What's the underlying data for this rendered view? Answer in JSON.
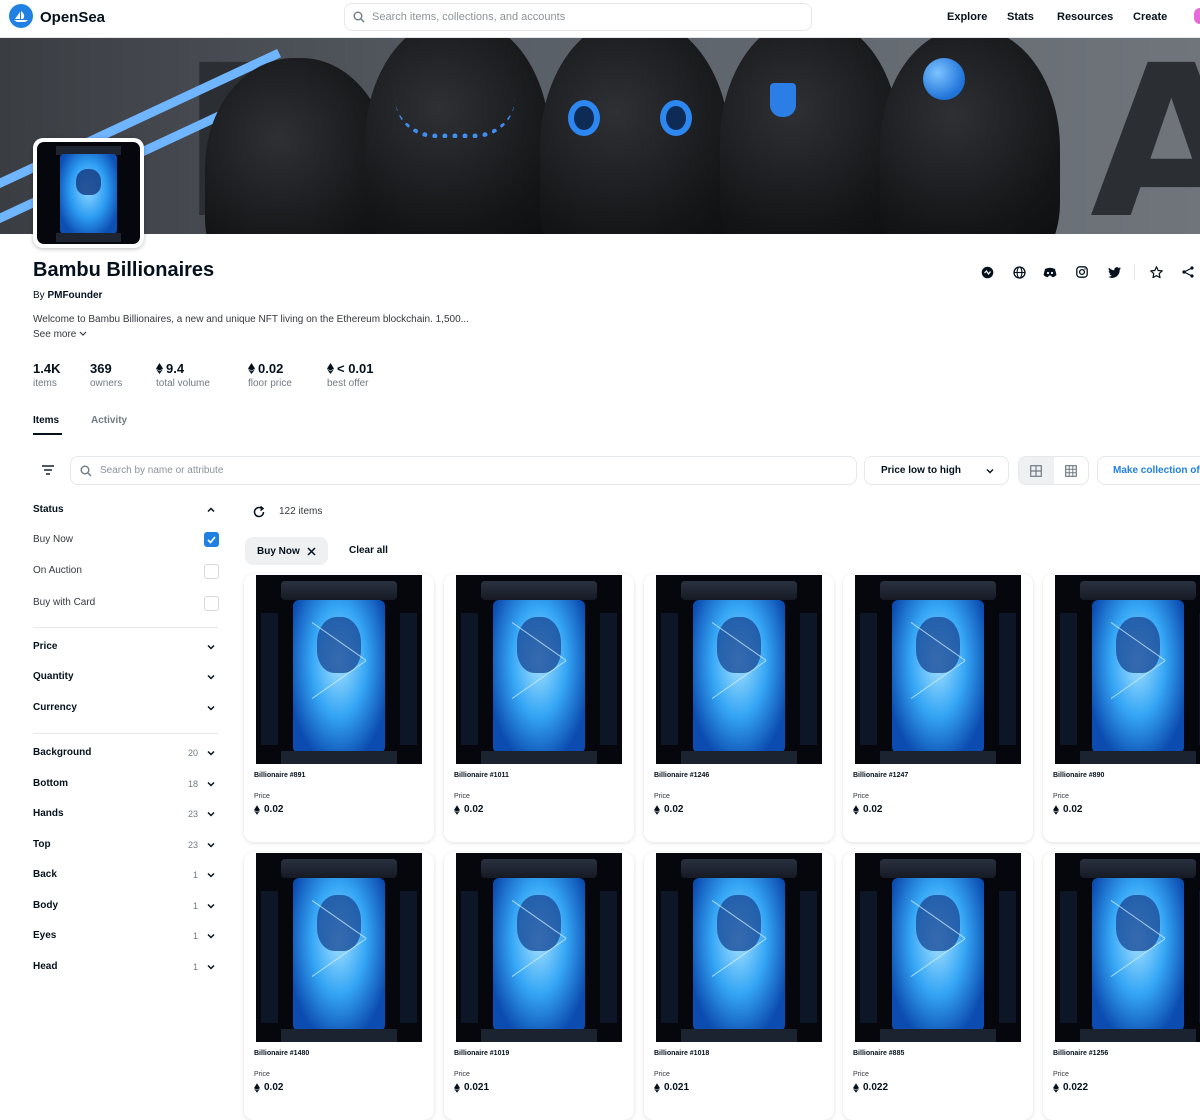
{
  "header": {
    "brand": "OpenSea",
    "search_placeholder": "Search items, collections, and accounts",
    "nav": [
      "Explore",
      "Stats",
      "Resources",
      "Create"
    ]
  },
  "collection": {
    "name": "Bambu Billionaires",
    "by_label": "By",
    "creator": "PMFounder",
    "description": "Welcome to Bambu Billionaires, a new and unique NFT living on the Ethereum blockchain. 1,500...",
    "see_more": "See more"
  },
  "stats": [
    {
      "value": "1.4K",
      "label": "items",
      "eth": false
    },
    {
      "value": "369",
      "label": "owners",
      "eth": false
    },
    {
      "value": "9.4",
      "label": "total volume",
      "eth": true
    },
    {
      "value": "0.02",
      "label": "floor price",
      "eth": true
    },
    {
      "value": "< 0.01",
      "label": "best offer",
      "eth": true
    }
  ],
  "tabs": [
    "Items",
    "Activity"
  ],
  "toolbar": {
    "search_placeholder": "Search by name or attribute",
    "sort": "Price low to high",
    "make_offer": "Make collection offer"
  },
  "sidebar": {
    "status_title": "Status",
    "status_options": [
      {
        "label": "Buy Now",
        "checked": true
      },
      {
        "label": "On Auction",
        "checked": false
      },
      {
        "label": "Buy with Card",
        "checked": false
      }
    ],
    "filters": [
      "Price",
      "Quantity",
      "Currency"
    ],
    "traits": [
      {
        "label": "Background",
        "count": "20"
      },
      {
        "label": "Bottom",
        "count": "18"
      },
      {
        "label": "Hands",
        "count": "23"
      },
      {
        "label": "Top",
        "count": "23"
      },
      {
        "label": "Back",
        "count": "1"
      },
      {
        "label": "Body",
        "count": "1"
      },
      {
        "label": "Eyes",
        "count": "1"
      },
      {
        "label": "Head",
        "count": "1"
      }
    ]
  },
  "results": {
    "count": "122 items",
    "active_filter": "Buy Now",
    "clear_all": "Clear all",
    "price_label": "Price",
    "items": [
      {
        "name": "Billionaire #891",
        "price": "0.02"
      },
      {
        "name": "Billionaire #1011",
        "price": "0.02"
      },
      {
        "name": "Billionaire #1246",
        "price": "0.02"
      },
      {
        "name": "Billionaire #1247",
        "price": "0.02"
      },
      {
        "name": "Billionaire #890",
        "price": "0.02"
      },
      {
        "name": "Billionaire #1480",
        "price": "0.02"
      },
      {
        "name": "Billionaire #1019",
        "price": "0.021"
      },
      {
        "name": "Billionaire #1018",
        "price": "0.021"
      },
      {
        "name": "Billionaire #885",
        "price": "0.022"
      },
      {
        "name": "Billionaire #1256",
        "price": "0.022"
      }
    ]
  },
  "colors": {
    "accent": "#2081e2",
    "text": "#04111d",
    "muted": "#707a83",
    "border": "#e5e8eb"
  }
}
